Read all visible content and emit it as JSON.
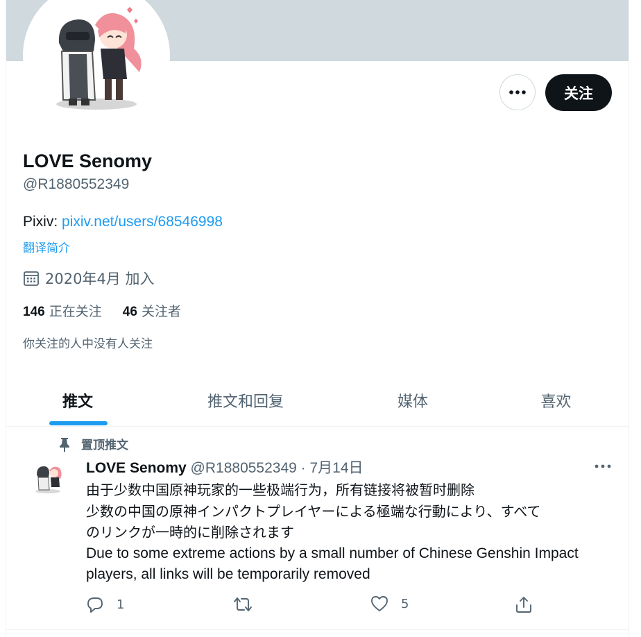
{
  "profile": {
    "name": "LOVE Senomy",
    "handle": "@R1880552349",
    "bio_prefix": "Pixiv: ",
    "bio_link": "pixiv.net/users/68546998",
    "translate": "翻译简介",
    "joined": "2020年4月 加入",
    "following_count": "146",
    "following_label": "正在关注",
    "followers_count": "46",
    "followers_label": "关注者",
    "mutuals_note": "你关注的人中没有人关注"
  },
  "header": {
    "follow_label": "关注",
    "more_icon": "more-horizontal-icon"
  },
  "tabs": [
    {
      "label": "推文",
      "active": true
    },
    {
      "label": "推文和回复",
      "active": false
    },
    {
      "label": "媒体",
      "active": false
    },
    {
      "label": "喜欢",
      "active": false
    }
  ],
  "tweet": {
    "pinned_label": "置顶推文",
    "author": "LOVE Senomy",
    "handle_date": "@R1880552349 · 7月14日",
    "lines": [
      "由于少数中国原神玩家的一些极端行为，所有链接将被暂时删除",
      "少数の中国の原神インパクトプレイヤーによる極端な行動により、すべて",
      "のリンクが一時的に削除されます",
      "Due to some extreme actions by a small number of Chinese Genshin Impact",
      "players, all links will be temporarily removed"
    ],
    "reply_count": "1",
    "retweet_count": "",
    "like_count": "5"
  },
  "colors": {
    "accent": "#1d9bf0",
    "banner": "#cfd9de",
    "text": "#0f1419",
    "muted": "#536471"
  }
}
